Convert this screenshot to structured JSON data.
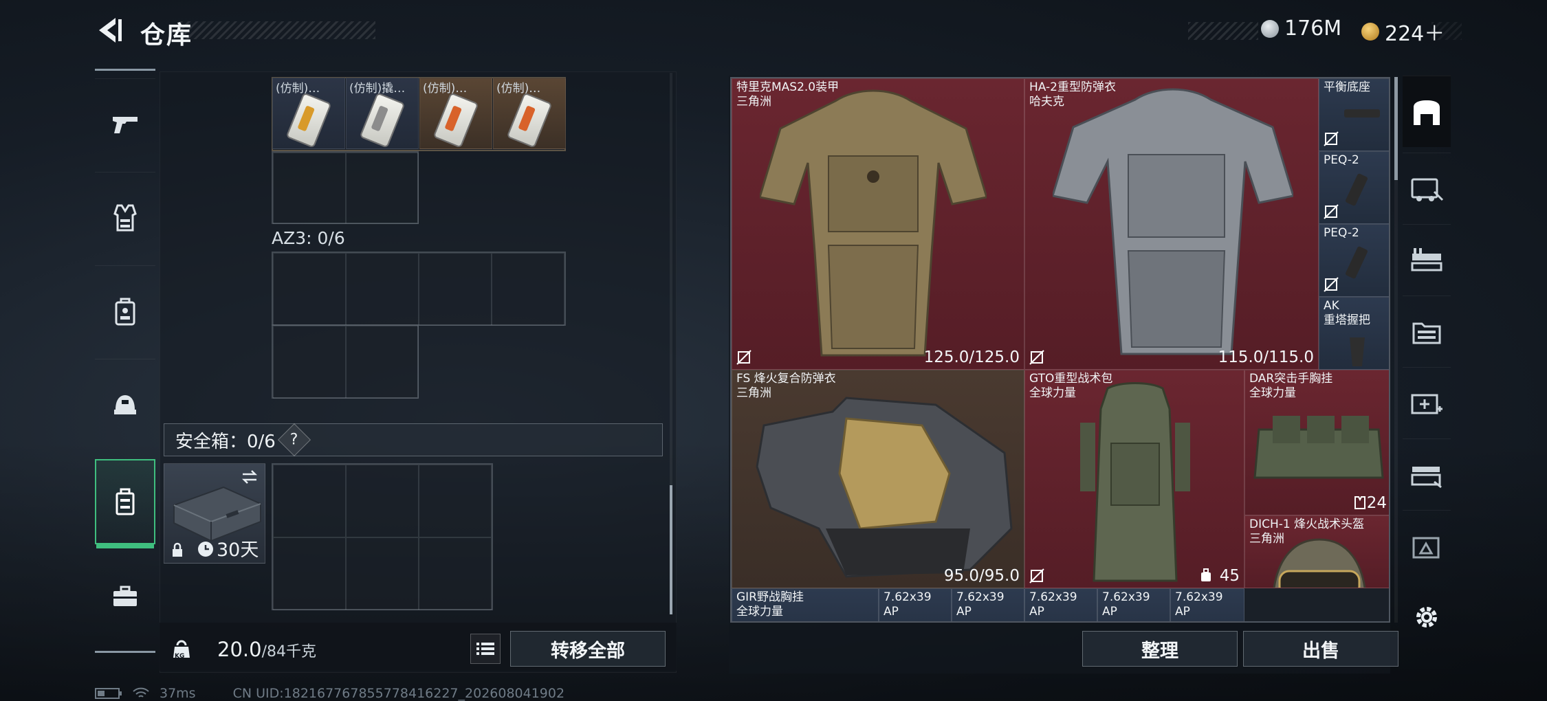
{
  "header": {
    "title": "仓库",
    "currency1": "176M",
    "currency2": "224＋",
    "currency1_color": "#aeb6bf",
    "currency2_color": "#d9a441",
    "back_icon": "back-arrow-icon"
  },
  "categories": [
    {
      "name": "weapons",
      "icon": "pistol-icon"
    },
    {
      "name": "armor",
      "icon": "vest-icon"
    },
    {
      "name": "backpack",
      "icon": "backpack-icon"
    },
    {
      "name": "helmet",
      "icon": "helmet-icon"
    },
    {
      "name": "safebox",
      "icon": "safebox-icon",
      "active": true
    },
    {
      "name": "toolbox",
      "icon": "toolbox-icon"
    }
  ],
  "storage": {
    "items": [
      {
        "label": "(仿制)…",
        "rarity": "blue",
        "strip": "#d89a2a"
      },
      {
        "label": "(仿制)撬…",
        "rarity": "blue",
        "strip": "#8c8c8c"
      },
      {
        "label": "(仿制)…",
        "rarity": "gold",
        "strip": "#d8622a"
      },
      {
        "label": "(仿制)…",
        "rarity": "gold",
        "strip": "#d8622a"
      }
    ],
    "az3_label": "AZ3: 0/6",
    "safebox_label": "安全箱：0/6",
    "safebox_help": "?",
    "safebox_duration": "30天",
    "weight": "20.0",
    "weight_max": "/84千克",
    "kg_label": "KG",
    "transfer_all": "转移全部"
  },
  "stash": {
    "items": [
      {
        "name": "特里克MAS2.0装甲",
        "sub": "三角洲",
        "value": "125.0/125.0",
        "rarity": "red"
      },
      {
        "name": "HA-2重型防弹衣",
        "sub": "哈夫克",
        "value": "115.0/115.0",
        "rarity": "red"
      },
      {
        "name": "平衡底座",
        "sub": "",
        "value": "",
        "rarity": "blue"
      },
      {
        "name": "PEQ-2",
        "sub": "",
        "value": "",
        "rarity": "blue"
      },
      {
        "name": "PEQ-2",
        "sub": "",
        "value": "",
        "rarity": "blue"
      },
      {
        "name": "AK",
        "sub": "重塔握把",
        "value": "",
        "rarity": "blue"
      },
      {
        "name": "FS 烽火复合防弹衣",
        "sub": "三角洲",
        "value": "95.0/95.0",
        "rarity": "brown"
      },
      {
        "name": "GTO重型战术包",
        "sub": "全球力量",
        "value": "45",
        "rarity": "red"
      },
      {
        "name": "DAR突击手胸挂",
        "sub": "全球力量",
        "value": "24",
        "rarity": "red"
      },
      {
        "name": "DICH-1 烽火战术头盔",
        "sub": "三角洲",
        "value": "",
        "rarity": "red"
      },
      {
        "name": "GIR野战胸挂",
        "sub": "全球力量",
        "value": "",
        "rarity": "blue"
      },
      {
        "name": "7.62x39",
        "sub": "AP",
        "value": "",
        "rarity": "blue"
      },
      {
        "name": "7.62x39",
        "sub": "AP",
        "value": "",
        "rarity": "blue"
      },
      {
        "name": "7.62x39",
        "sub": "AP",
        "value": "",
        "rarity": "blue"
      },
      {
        "name": "7.62x39",
        "sub": "AP",
        "value": "",
        "rarity": "blue"
      },
      {
        "name": "7.62x39",
        "sub": "AP",
        "value": "",
        "rarity": "blue"
      }
    ],
    "sort_button": "整理",
    "sell_button": "出售"
  },
  "side_tabs": [
    "stash-home-icon",
    "vehicle-icon",
    "weapon-bench-icon",
    "folders-icon",
    "medkit-icon",
    "gun-upgrade-icon",
    "stack-icon",
    "settings-gear-icon"
  ],
  "status": {
    "ping": "37ms",
    "uid": "CN UID:1821677678557784162​27_202608041902"
  }
}
